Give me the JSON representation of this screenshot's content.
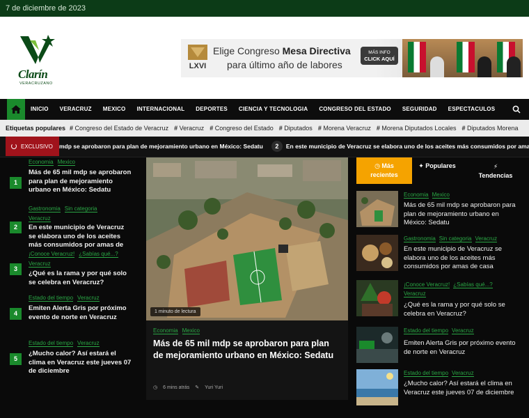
{
  "topbar": {
    "date": "7 de diciembre de 2023"
  },
  "logo": {
    "name": "Clarín",
    "subtitle": "VERACRUZANO"
  },
  "banner": {
    "line1_prefix": "Elige Congreso ",
    "line1_bold": "Mesa Directiva",
    "line2": "para último año de labores",
    "badge_text": "LXVI",
    "button_line1": "MÁS INFO",
    "button_line2": "CLICK AQUÍ"
  },
  "nav": {
    "items": [
      "INICIO",
      "VERACRUZ",
      "MEXICO",
      "INTERNACIONAL",
      "DEPORTES",
      "CIENCIA Y TECNOLOGIA",
      "CONGRESO DEL ESTADO",
      "SEGURIDAD",
      "ESPECTACULOS"
    ]
  },
  "tags": {
    "label": "Etiquetas populares",
    "items": [
      "Congreso del Estado de Veracruz",
      "Veracruz",
      "Congreso del Estado",
      "Diputados",
      "Morena Veracruz",
      "Morena Diputados Locales",
      "Diputados Morena"
    ]
  },
  "ticker": {
    "badge": "EXCLUSIVO",
    "items": [
      {
        "num": "",
        "text": "mdp se aprobaron para plan de mejoramiento urbano en México: Sedatu"
      },
      {
        "num": "2",
        "text": "En este municipio de Veracruz se elabora uno de los aceites más consumidos por amas de c"
      }
    ]
  },
  "left_list": [
    {
      "num": "1",
      "cats": [
        "Economia",
        "Mexico"
      ],
      "title": "Más de 65 mil mdp se aprobaron para plan de mejoramiento urbano en México: Sedatu"
    },
    {
      "num": "2",
      "cats": [
        "Gastronomia",
        "Sin categoria",
        "Veracruz"
      ],
      "title": "En este municipio de Veracruz se elabora uno de los aceites más consumidos por amas de"
    },
    {
      "num": "3",
      "cats": [
        "¡Conoce Veracruz!",
        "¿Sabías qué...?",
        "Veracruz"
      ],
      "title": "¿Qué es la rama y por qué solo se celebra en Veracruz?"
    },
    {
      "num": "4",
      "cats": [
        "Estado del tiempo",
        "Veracruz"
      ],
      "title": "Emiten Alerta Gris por próximo evento de norte en Veracruz"
    },
    {
      "num": "5",
      "cats": [
        "Estado del tiempo",
        "Veracruz"
      ],
      "title": "¿Mucho calor? Así estará el clima en Veracruz este jueves 07 de diciembre"
    }
  ],
  "feature": {
    "read_time": "1 minuto de lectura",
    "cats": [
      "Economia",
      "Mexico"
    ],
    "title": "Más de 65 mil mdp se aprobaron para plan de mejoramiento urbano en México: Sedatu",
    "time": "6 mins atrás",
    "author": "Yuri Yuri"
  },
  "tabs": {
    "recent_l1": "Más",
    "recent_l2": "recientes",
    "popular": "Populares",
    "trending": "Tendencias"
  },
  "right_list": [
    {
      "cats": [
        "Economia",
        "Mexico"
      ],
      "title": "Más de 65 mil mdp se aprobaron para plan de mejoramiento urbano en México: Sedatu"
    },
    {
      "cats": [
        "Gastronomia",
        "Sin categoria",
        "Veracruz"
      ],
      "title": "En este municipio de Veracruz se elabora uno de los aceites más consumidos por amas de casa"
    },
    {
      "cats": [
        "¡Conoce Veracruz!",
        "¿Sabías qué...?",
        "Veracruz"
      ],
      "title": "¿Qué es la rama y por qué solo se celebra en Veracruz?"
    },
    {
      "cats": [
        "Estado del tiempo",
        "Veracruz"
      ],
      "title": "Emiten Alerta Gris por próximo evento de norte en Veracruz"
    },
    {
      "cats": [
        "Estado del tiempo",
        "Veracruz"
      ],
      "title": "¿Mucho calor? Así estará el clima en Veracruz este jueves 07 de diciembre"
    }
  ],
  "colors": {
    "brand_green": "#1a8a2c",
    "accent_orange": "#f5a300",
    "exclusive_red": "#a0131b"
  }
}
